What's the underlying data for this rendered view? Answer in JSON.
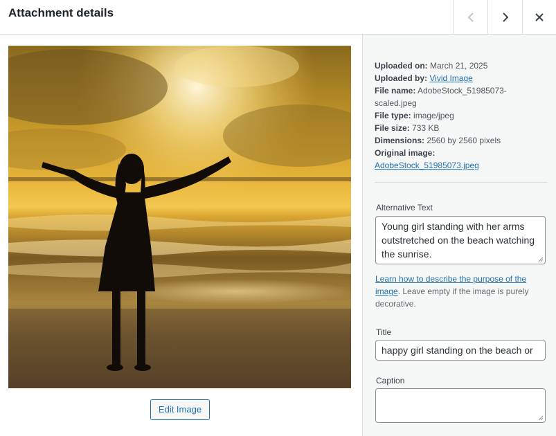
{
  "header": {
    "title": "Attachment details",
    "prev_icon": "chevron-left-icon",
    "next_icon": "chevron-right-icon",
    "close_icon": "close-icon"
  },
  "preview": {
    "image_alt": "Young girl standing with her arms outstretched on the beach watching the sunrise.",
    "edit_button": "Edit Image"
  },
  "details": {
    "uploaded_on_label": "Uploaded on:",
    "uploaded_on": "March 21, 2025",
    "uploaded_by_label": "Uploaded by:",
    "uploaded_by": "Vivid Image",
    "file_name_label": "File name:",
    "file_name_line1": "AdobeStock_51985073-",
    "file_name_line2": "scaled.jpeg",
    "file_type_label": "File type:",
    "file_type": "image/jpeg",
    "file_size_label": "File size:",
    "file_size": "733 KB",
    "dimensions_label": "Dimensions:",
    "dimensions": "2560 by 2560 pixels",
    "original_label": "Original image:",
    "original": "AdobeStock_51985073.jpeg"
  },
  "fields": {
    "alt_label": "Alternative Text",
    "alt_value": "Young girl standing with her arms outstretched on the beach watching the sunrise.",
    "help_link_line1": "Learn how to describe the purpose of the",
    "help_link_line2": "image",
    "help_text_line1": ". Leave empty if the image is purely",
    "help_text_line2": "decorative.",
    "title_label": "Title",
    "title_value": "happy girl standing on the beach or",
    "caption_label": "Caption",
    "caption_value": ""
  },
  "colors": {
    "accent": "#2271b1",
    "sidebar_bg": "#f6f7f7",
    "border": "#dcdcde"
  }
}
